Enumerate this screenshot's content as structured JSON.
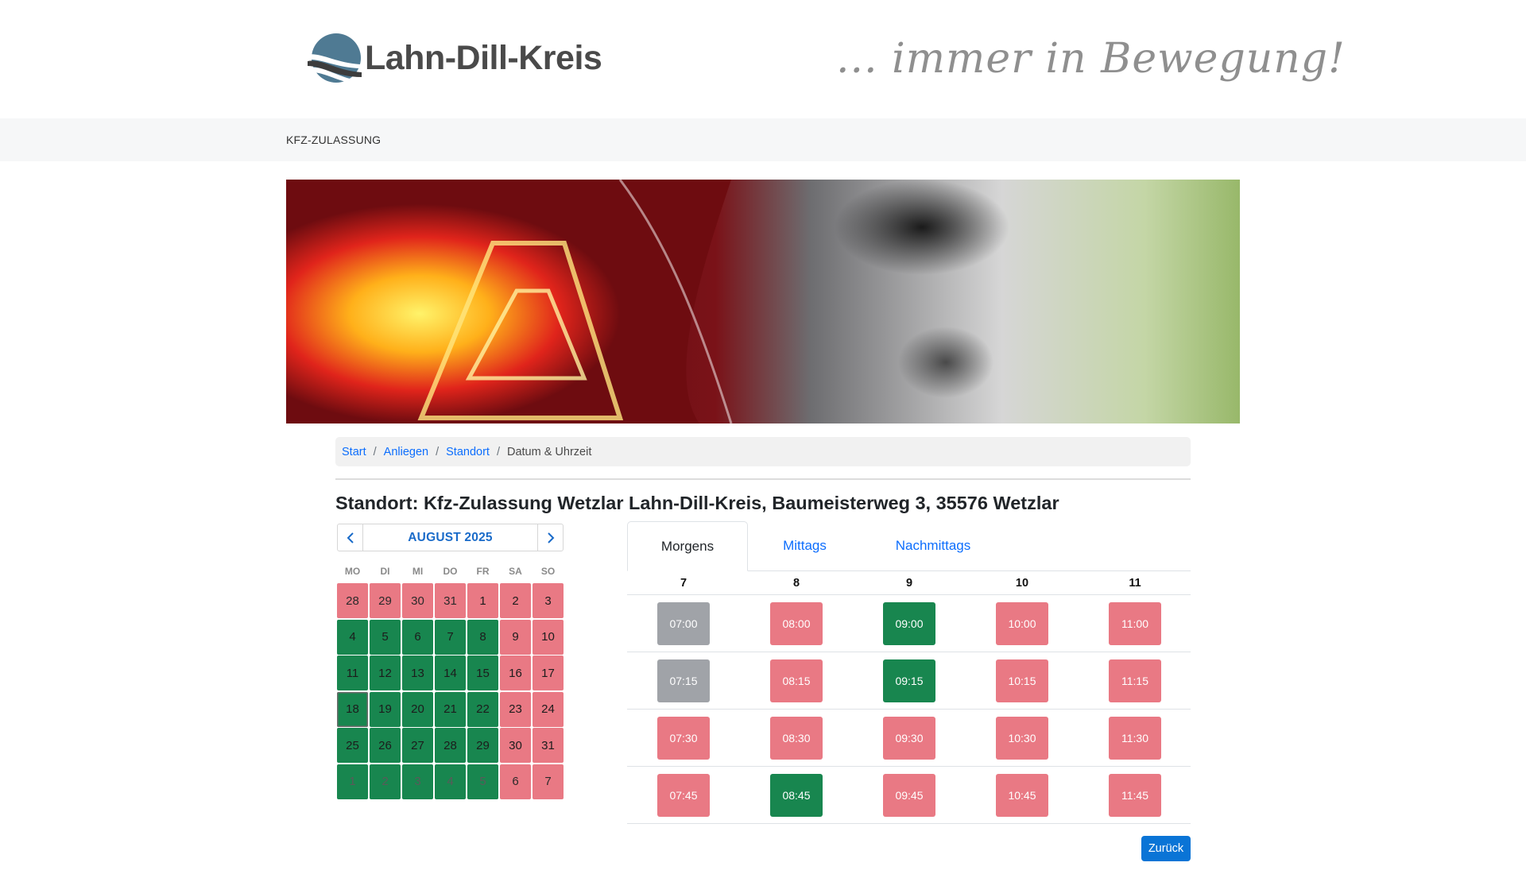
{
  "header": {
    "logo_text": "Lahn-Dill-Kreis",
    "slogan": "... immer in Bewegung!"
  },
  "nav": {
    "item": "KFZ-ZULASSUNG"
  },
  "breadcrumb": {
    "items": [
      "Start",
      "Anliegen",
      "Standort"
    ],
    "current": "Datum & Uhrzeit",
    "separator": "/"
  },
  "title": "Standort: Kfz-Zulassung Wetzlar Lahn-Dill-Kreis, Baumeisterweg 3, 35576 Wetzlar",
  "calendar": {
    "month_label": "AUGUST 2025",
    "weekdays": [
      "MO",
      "DI",
      "MI",
      "DO",
      "FR",
      "SA",
      "SO"
    ],
    "weeks": [
      [
        "28",
        "29",
        "30",
        "31",
        "1",
        "2",
        "3"
      ],
      [
        "4",
        "5",
        "6",
        "7",
        "8",
        "9",
        "10"
      ],
      [
        "11",
        "12",
        "13",
        "14",
        "15",
        "16",
        "17"
      ],
      [
        "18",
        "19",
        "20",
        "21",
        "22",
        "23",
        "24"
      ],
      [
        "25",
        "26",
        "27",
        "28",
        "29",
        "30",
        "31"
      ],
      [
        "1",
        "2",
        "3",
        "4",
        "5",
        "6",
        "7"
      ]
    ],
    "colors": {
      "available": "#18864f",
      "unavailable": "#e97984"
    }
  },
  "tabs": [
    "Morgens",
    "Mittags",
    "Nachmittags"
  ],
  "time_table": {
    "hours": [
      "7",
      "8",
      "9",
      "10",
      "11"
    ],
    "rows": [
      [
        "07:00",
        "08:00",
        "09:00",
        "10:00",
        "11:00"
      ],
      [
        "07:15",
        "08:15",
        "09:15",
        "10:15",
        "11:15"
      ],
      [
        "07:30",
        "08:30",
        "09:30",
        "10:30",
        "11:30"
      ],
      [
        "07:45",
        "08:45",
        "09:45",
        "10:45",
        "11:45"
      ]
    ]
  },
  "back_button": "Zurück"
}
